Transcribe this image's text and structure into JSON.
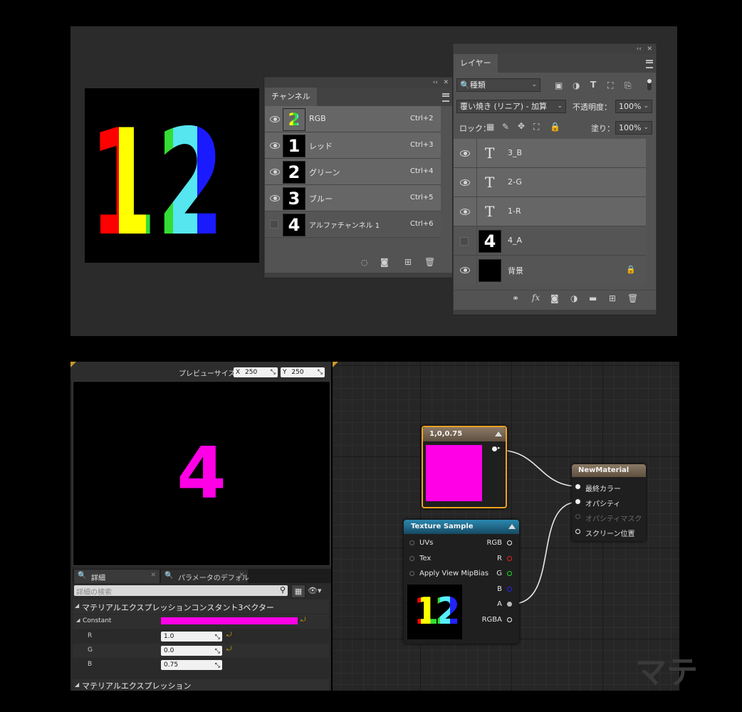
{
  "colors": {
    "magenta": "#ff00e6",
    "ps_panel": "#535353",
    "ue_header_blue": "#1f6b8c",
    "ue_header_brown": "#6b5a48",
    "selected_node_border": "#f0a020"
  },
  "photoshop": {
    "canvas_image_text": "12",
    "channels_panel": {
      "tab": "チャンネル",
      "rows": [
        {
          "thumb": "2",
          "name": "RGB",
          "shortcut": "Ctrl+2",
          "visible": true
        },
        {
          "thumb": "1",
          "name": "レッド",
          "shortcut": "Ctrl+3",
          "visible": true
        },
        {
          "thumb": "2",
          "name": "グリーン",
          "shortcut": "Ctrl+4",
          "visible": true
        },
        {
          "thumb": "3",
          "name": "ブルー",
          "shortcut": "Ctrl+5",
          "visible": true
        },
        {
          "thumb": "4",
          "name": "アルファチャンネル 1",
          "shortcut": "Ctrl+6",
          "visible": false
        }
      ],
      "footer_icons": [
        "dotted-selection-icon",
        "mask-icon",
        "new-channel-icon",
        "trash-icon"
      ]
    },
    "layers_panel": {
      "tab": "レイヤー",
      "filter_kind": "種類",
      "blend_mode": "覆い焼き (リニア) - 加算",
      "opacity_label": "不透明度：",
      "opacity_value": "100%",
      "lock_label": "ロック：",
      "fill_label": "塗り：",
      "fill_value": "100%",
      "layers": [
        {
          "type": "text",
          "thumb": "T",
          "name": "3_B",
          "visible": true
        },
        {
          "type": "text",
          "thumb": "T",
          "name": "2-G",
          "visible": true
        },
        {
          "type": "text",
          "thumb": "T",
          "name": "1-R",
          "visible": true
        },
        {
          "type": "image",
          "thumb": "4",
          "name": "4_A",
          "visible": false
        },
        {
          "type": "image",
          "thumb": "",
          "name": "背景",
          "visible": true,
          "locked": true
        }
      ]
    }
  },
  "unreal": {
    "preview": {
      "size_label": "プレビューサイズ",
      "x_label": "X",
      "x_value": "250",
      "y_label": "Y",
      "y_value": "250",
      "glyph": "4"
    },
    "tabs": [
      {
        "label": "詳細"
      },
      {
        "label": "パラメータのデフォル"
      }
    ],
    "search_placeholder": "詳細の検索",
    "details": {
      "section1": "マテリアルエクスプレッションコンスタント3ベクター",
      "constant_label": "Constant",
      "r_label": "R",
      "r_value": "1.0",
      "g_label": "G",
      "g_value": "0.0",
      "b_label": "B",
      "b_value": "0.75",
      "section2": "マテリアルエクスプレッション"
    },
    "graph": {
      "constant_node_title": "1,0,0.75",
      "texture_node": {
        "title": "Texture Sample",
        "inputs": [
          "UVs",
          "Tex",
          "Apply View MipBias"
        ],
        "outputs": [
          "RGB",
          "R",
          "G",
          "B",
          "A",
          "RGBA"
        ],
        "thumb_text": "12"
      },
      "material_node": {
        "title": "NewMaterial",
        "inputs": [
          "最終カラー",
          "オパシティ",
          "オパシティマスク",
          "スクリーン位置"
        ]
      },
      "watermark": "マテ"
    }
  }
}
